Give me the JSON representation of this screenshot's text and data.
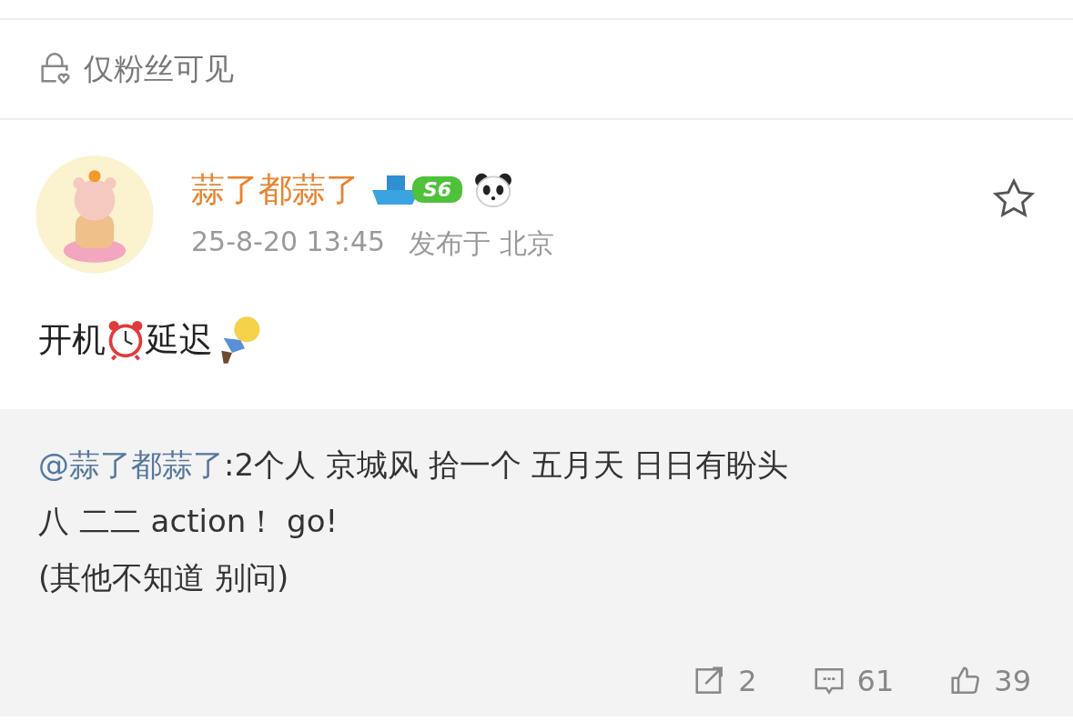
{
  "visibility": {
    "label": "仅粉丝可见"
  },
  "post": {
    "author": "蒜了都蒜了",
    "level_badge": "S6",
    "time": "25-8-20 13:45",
    "location": "发布于 北京",
    "favorited": false,
    "content": [
      {
        "kind": "text",
        "text": "开机"
      },
      {
        "kind": "clock"
      },
      {
        "kind": "text",
        "text": "延迟"
      },
      {
        "kind": "lying"
      }
    ]
  },
  "quote": {
    "mention": "@蒜了都蒜了",
    "lines": [
      ":2个人 京城风 拾一个 五月天 日日有盼头",
      "八 二二 action！ go!",
      "(其他不知道 别问)"
    ]
  },
  "actions": [
    {
      "kind": "repost",
      "count": "2"
    },
    {
      "kind": "comment",
      "count": "61"
    },
    {
      "kind": "like",
      "count": "39"
    }
  ]
}
